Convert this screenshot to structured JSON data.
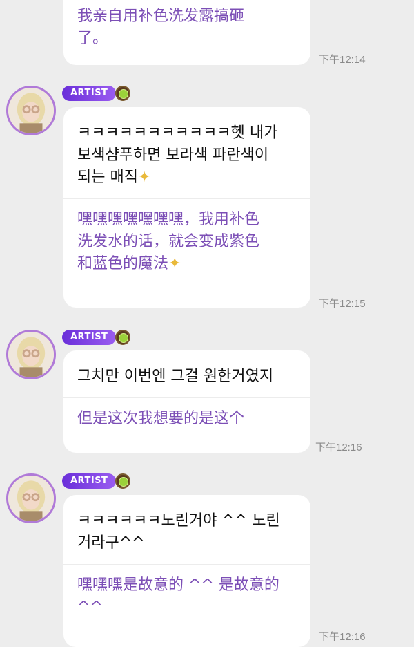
{
  "messages": [
    {
      "zh": "我亲自用补色洗发露搞砸\n了。",
      "time": "下午12:14"
    },
    {
      "badge": "ARTIST",
      "ko": "ㅋㅋㅋㅋㅋㅋㅋㅋㅋㅋㅋ헷 내가\n보색샴푸하면 보라색 파란색이\n되는 매직",
      "zh": "嘿嘿嘿嘿嘿嘿嘿，我用补色\n洗发水的话，就会变成紫色\n和蓝色的魔法",
      "time": "下午12:15"
    },
    {
      "badge": "ARTIST",
      "ko": "그치만 이번엔 그걸 원한거였지",
      "zh": "但是这次我想要的是这个",
      "time": "下午12:16"
    },
    {
      "badge": "ARTIST",
      "ko": "ㅋㅋㅋㅋㅋㅋ노린거야 ^^ 노린\n거라구^^",
      "zh": "嘿嘿嘿是故意的 ^^ 是故意的\n^^",
      "time": "下午12:16"
    }
  ],
  "icons": {
    "emoji": "dizzy-sparkle",
    "sticker": "kiwi"
  }
}
